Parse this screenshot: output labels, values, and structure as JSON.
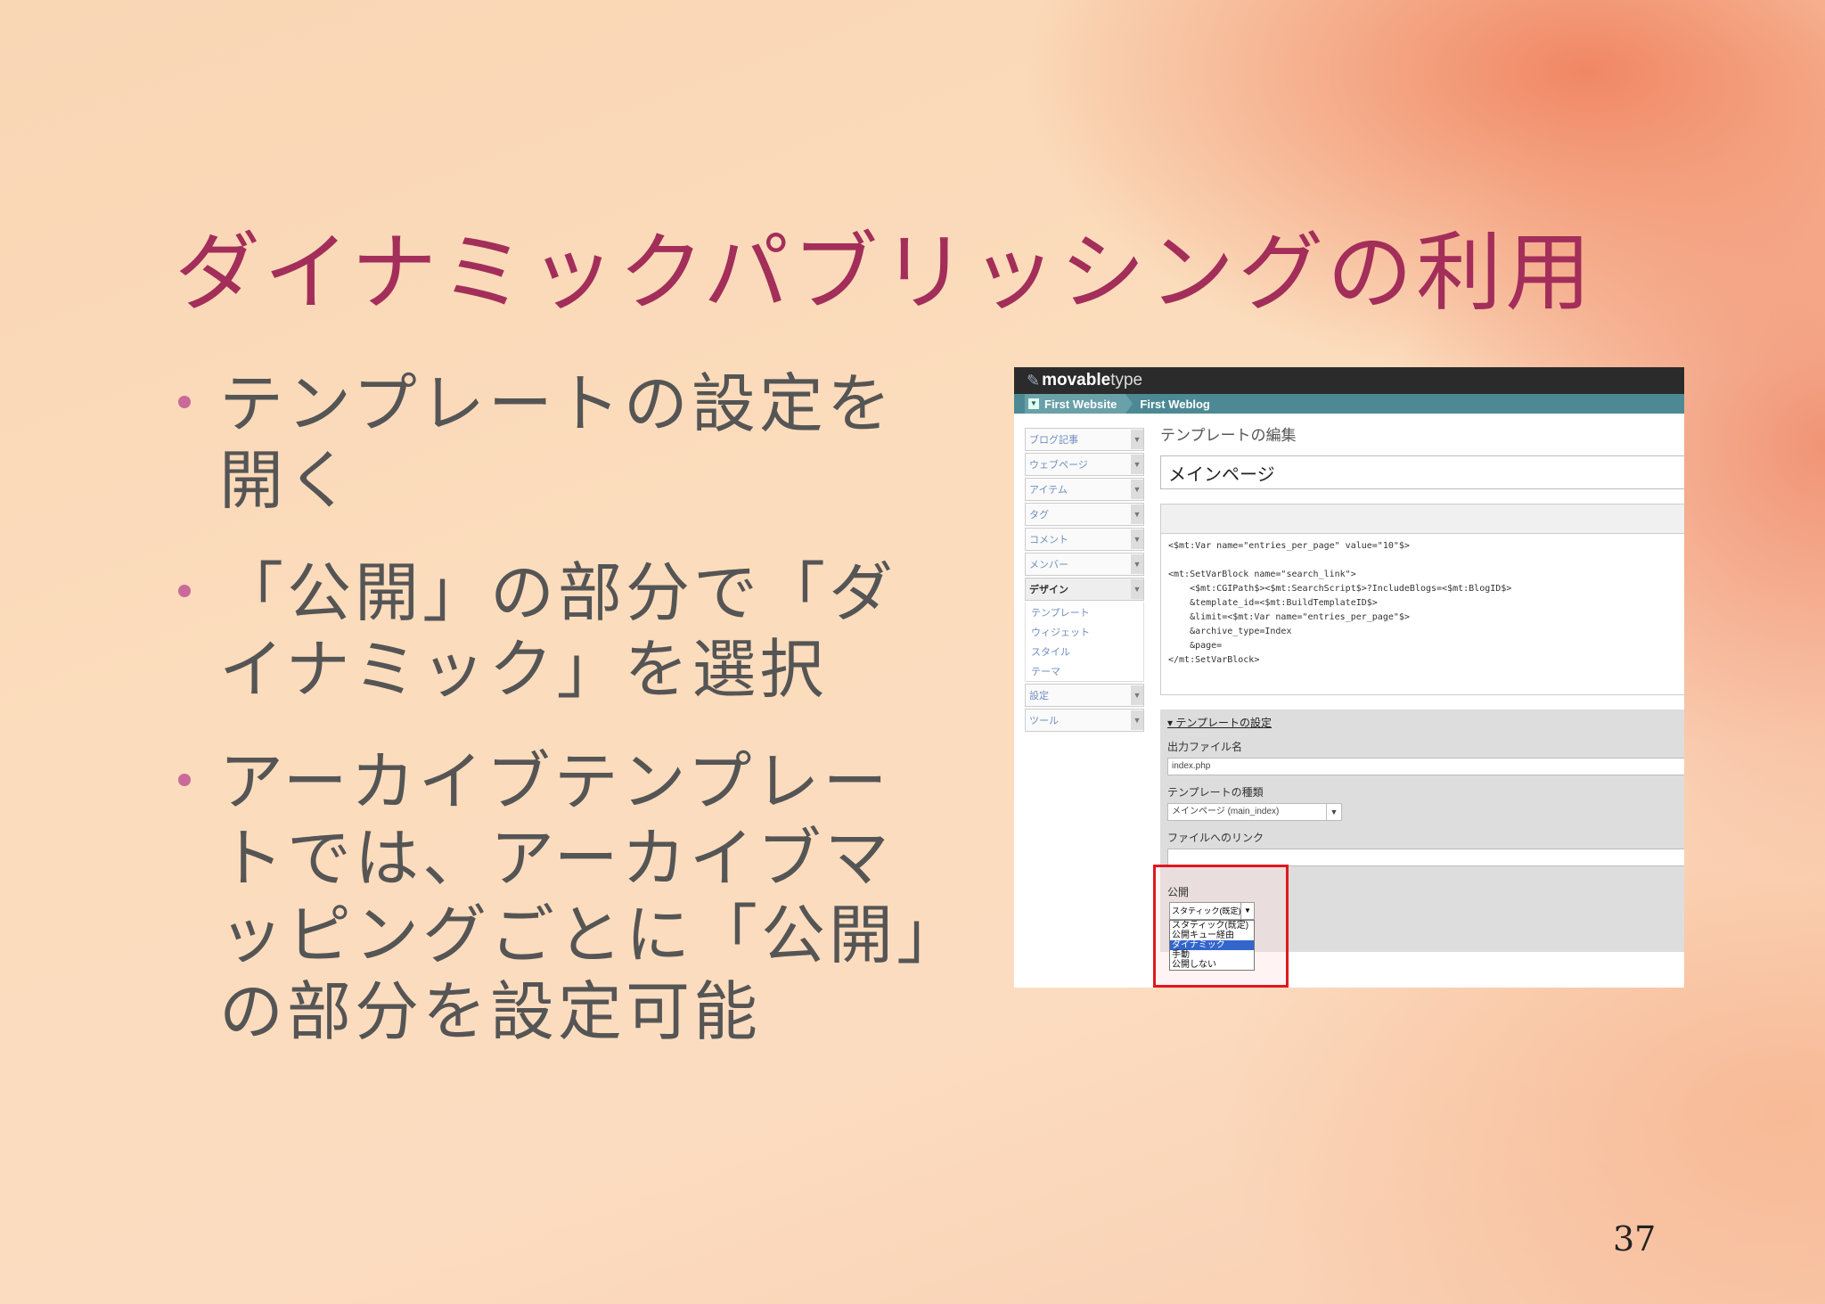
{
  "slide": {
    "title": "ダイナミックパブリッシングの利用",
    "bullets": [
      "テンプレートの設定を開く",
      "「公開」の部分で「ダイナミック」を選択",
      "アーカイブテンプレートでは、アーカイブマッピングごとに「公開」の部分を設定可能"
    ],
    "page_number": "37"
  },
  "screenshot": {
    "logo_bold": "movable",
    "logo_light": "type",
    "breadcrumb_website": "First Website",
    "breadcrumb_blog": "First Weblog",
    "nav": [
      "ブログ記事",
      "ウェブページ",
      "アイテム",
      "タグ",
      "コメント",
      "メンバー"
    ],
    "nav_active": "デザイン",
    "nav_sub": [
      "テンプレート",
      "ウィジェット",
      "スタイル",
      "テーマ"
    ],
    "nav_after": [
      "設定",
      "ツール"
    ],
    "heading": "テンプレートの編集",
    "template_name": "メインページ",
    "code": "<$mt:Var name=\"entries_per_page\" value=\"10\"$>\n\n<mt:SetVarBlock name=\"search_link\">\n    <$mt:CGIPath$><$mt:SearchScript$>?IncludeBlogs=<$mt:BlogID$>\n    &template_id=<$mt:BuildTemplateID$>\n    &limit=<$mt:Var name=\"entries_per_page\"$>\n    &archive_type=Index\n    &page=\n</mt:SetVarBlock>",
    "settings_title": "▾ テンプレートの設定",
    "output_file_label": "出力ファイル名",
    "output_file_value": "index.php",
    "template_type_label": "テンプレートの種類",
    "template_type_value": "メインページ (main_index)",
    "file_link_label": "ファイルへのリンク",
    "publish_label": "公開",
    "publish_selected": "スタティック(既定)",
    "publish_options": [
      "スタティック(既定)",
      "公開キュー経由",
      "ダイナミック",
      "手動",
      "公開しない"
    ],
    "publish_highlighted_index": 2
  }
}
